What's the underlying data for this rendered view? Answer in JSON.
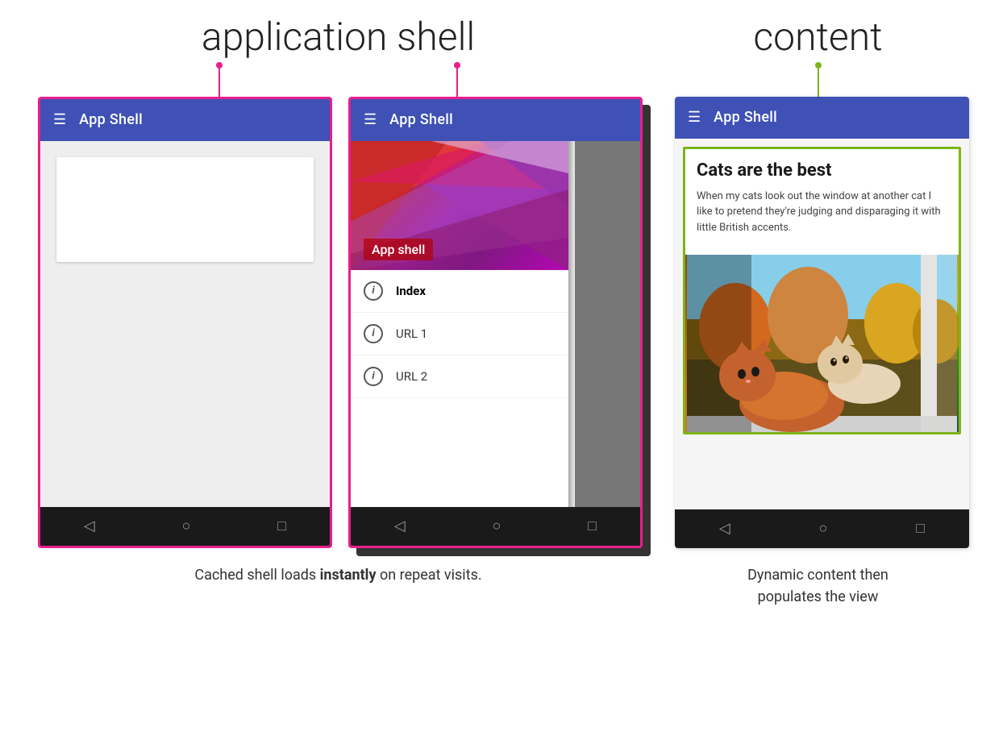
{
  "labels": {
    "app_shell_label": "application shell",
    "content_label": "content"
  },
  "phone1": {
    "toolbar_title": "App Shell",
    "hamburger": "☰"
  },
  "phone2": {
    "toolbar_title": "App Shell",
    "hamburger": "☰",
    "drawer_header_label": "App shell",
    "menu_items": [
      {
        "label": "Index",
        "bold": true
      },
      {
        "label": "URL 1",
        "bold": false
      },
      {
        "label": "URL 2",
        "bold": false
      }
    ]
  },
  "phone3": {
    "toolbar_title": "App Shell",
    "hamburger": "☰",
    "article_title": "Cats are the best",
    "article_body": "When my cats look out the window at another cat I like to pretend they're judging and disparaging it with little British accents."
  },
  "captions": {
    "left_part1": "Cached shell loads ",
    "left_bold": "instantly",
    "left_part2": " on repeat visits.",
    "right_line1": "Dynamic content then",
    "right_line2": "populates the view"
  },
  "nav": {
    "back": "◁",
    "home": "○",
    "recent": "□"
  }
}
